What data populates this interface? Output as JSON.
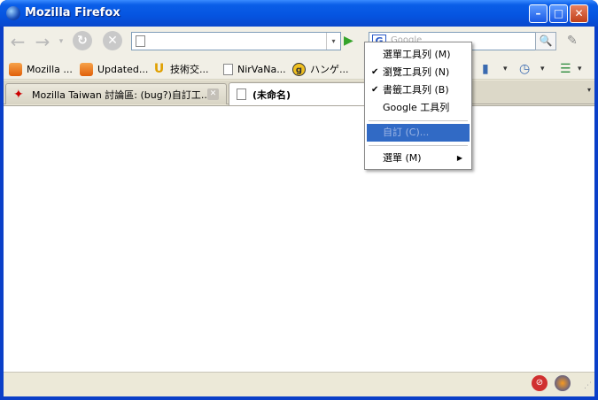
{
  "window": {
    "title": "Mozilla Firefox",
    "minimize": "–",
    "maximize": "□",
    "close": "✕"
  },
  "nav": {
    "back_icon": "←",
    "forward_icon": "→",
    "dropdown": "▾",
    "reload_icon": "↻",
    "stop_icon": "✕",
    "url_value": "",
    "go_icon": "▶",
    "search_engine_label": "G",
    "search_placeholder": "Google",
    "search_btn": "🔍",
    "feather_icon": "✎"
  },
  "bookmarks": [
    {
      "label": "Mozilla ...",
      "icon": "rss"
    },
    {
      "label": "Updated...",
      "icon": "rss"
    },
    {
      "label": "技術交...",
      "icon": "u"
    },
    {
      "label": "NirVaNa...",
      "icon": "page"
    },
    {
      "label": "ハンゲ...",
      "icon": "g"
    }
  ],
  "toolbar_icons": {
    "bookmark": "▮",
    "history": "◷",
    "sidebar": "☰",
    "drop": "▾"
  },
  "tabs": [
    {
      "label": "Mozilla Taiwan 討論區: (bug?)自訂工...",
      "active": false,
      "close": "✕"
    },
    {
      "label": "(未命名)",
      "active": true
    }
  ],
  "tab_list_btn": "▾",
  "menu": {
    "items": [
      {
        "label": "選單工具列 (M)",
        "checked": false
      },
      {
        "label": "瀏覽工具列 (N)",
        "checked": true
      },
      {
        "label": "書籤工具列 (B)",
        "checked": true
      },
      {
        "label": "Google 工具列",
        "checked": false
      },
      {
        "label": "自訂 (C)...",
        "disabled": true
      },
      {
        "label": "選單 (M)",
        "submenu": true
      }
    ],
    "check_mark": "✔",
    "submenu_arrow": "▶"
  },
  "status": {
    "grip": "⋰"
  }
}
